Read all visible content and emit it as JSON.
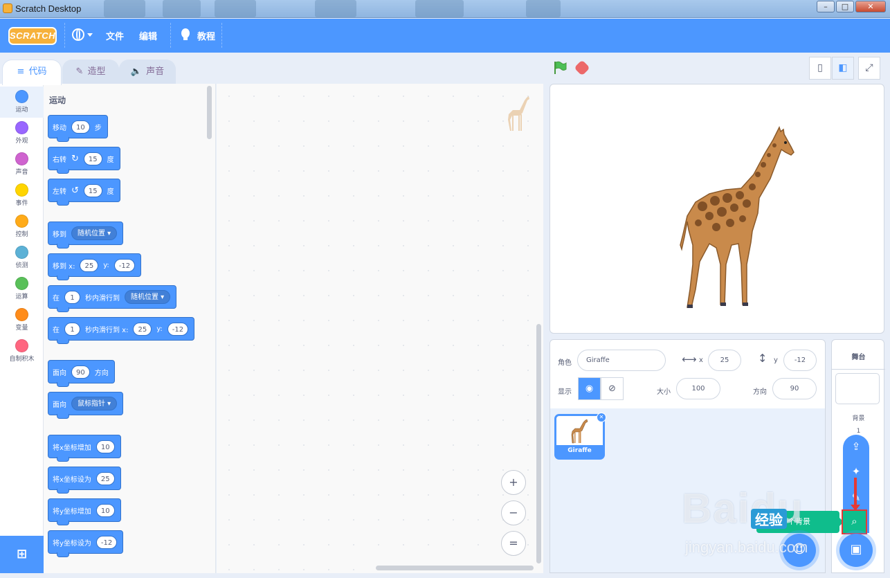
{
  "window": {
    "title": "Scratch Desktop",
    "buttons": [
      "–",
      "□",
      "✕"
    ]
  },
  "menubar": {
    "logo": "SCRATCH",
    "language_icon": "globe-icon",
    "file": "文件",
    "edit": "编辑",
    "tutorials": "教程"
  },
  "tabs": [
    {
      "label": "代码",
      "icon": "code-icon"
    },
    {
      "label": "造型",
      "icon": "brush-icon"
    },
    {
      "label": "声音",
      "icon": "speaker-icon"
    }
  ],
  "categories": [
    {
      "label": "运动",
      "color": "#4c97ff"
    },
    {
      "label": "外观",
      "color": "#9966ff"
    },
    {
      "label": "声音",
      "color": "#cf63cf"
    },
    {
      "label": "事件",
      "color": "#ffd500"
    },
    {
      "label": "控制",
      "color": "#ffab19"
    },
    {
      "label": "侦测",
      "color": "#5cb1d6"
    },
    {
      "label": "运算",
      "color": "#59c059"
    },
    {
      "label": "变量",
      "color": "#ff8c1a"
    },
    {
      "label": "自制积木",
      "color": "#ff6680"
    }
  ],
  "palette": {
    "title": "运动",
    "blocks": {
      "move": {
        "a": "移动",
        "n": "10",
        "b": "步"
      },
      "turn_right": {
        "a": "右转",
        "n": "15",
        "b": "度"
      },
      "turn_left": {
        "a": "左转",
        "n": "15",
        "b": "度"
      },
      "goto": {
        "a": "移到",
        "d": "随机位置"
      },
      "goto_xy": {
        "a": "移到 x:",
        "x": "25",
        "b": "y:",
        "y": "-12"
      },
      "glide": {
        "a": "在",
        "n": "1",
        "b": "秒内滑行到",
        "d": "随机位置"
      },
      "glide_xy": {
        "a": "在",
        "n": "1",
        "b": "秒内滑行到 x:",
        "x": "25",
        "c": "y:",
        "y": "-12"
      },
      "point_dir": {
        "a": "面向",
        "n": "90",
        "b": "方向"
      },
      "point_towards": {
        "a": "面向",
        "d": "鼠标指针"
      },
      "change_x": {
        "a": "将x坐标增加",
        "n": "10"
      },
      "set_x": {
        "a": "将x坐标设为",
        "n": "25"
      },
      "change_y": {
        "a": "将y坐标增加",
        "n": "10"
      },
      "set_y": {
        "a": "将y坐标设为",
        "n": "-12"
      }
    }
  },
  "zoom": {
    "in": "+",
    "out": "−",
    "reset": "="
  },
  "sprite_info": {
    "sprite_label": "角色",
    "sprite_name": "Giraffe",
    "x_label": "x",
    "x": "25",
    "y_label": "y",
    "y": "-12",
    "show_label": "显示",
    "size_label": "大小",
    "size": "100",
    "direction_label": "方向",
    "direction": "90"
  },
  "sprites": [
    {
      "name": "Giraffe"
    }
  ],
  "stage_pane": {
    "title": "舞台",
    "backdrop_label": "背景",
    "backdrop_count": "1"
  },
  "tooltip": "选择一个背景",
  "watermark": {
    "brand": "Baidu",
    "badge": "经验",
    "url": "jingyan.baidu.com"
  }
}
